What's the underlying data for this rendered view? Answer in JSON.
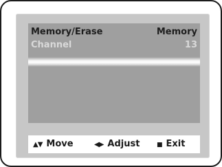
{
  "menu": {
    "rows": [
      {
        "label": "Memory/Erase",
        "value": "Memory",
        "state": "selected"
      },
      {
        "label": "Channel",
        "value": "13",
        "state": "dimmed"
      }
    ]
  },
  "footer": {
    "move_icon": "up-down-arrows-icon",
    "move_glyph": "▲▼",
    "move_label": "Move",
    "adjust_icon": "left-right-arrows-icon",
    "adjust_glyph": "◀▶",
    "adjust_label": "Adjust",
    "exit_icon": "stop-square-icon",
    "exit_glyph": "■",
    "exit_label": "Exit"
  },
  "colors": {
    "screen_background": "#c7c7c7",
    "panel_background": "#9f9f9f",
    "text_primary": "#1e1e1e",
    "text_dimmed": "#d9d9d9",
    "footer_background": "#ffffff"
  }
}
